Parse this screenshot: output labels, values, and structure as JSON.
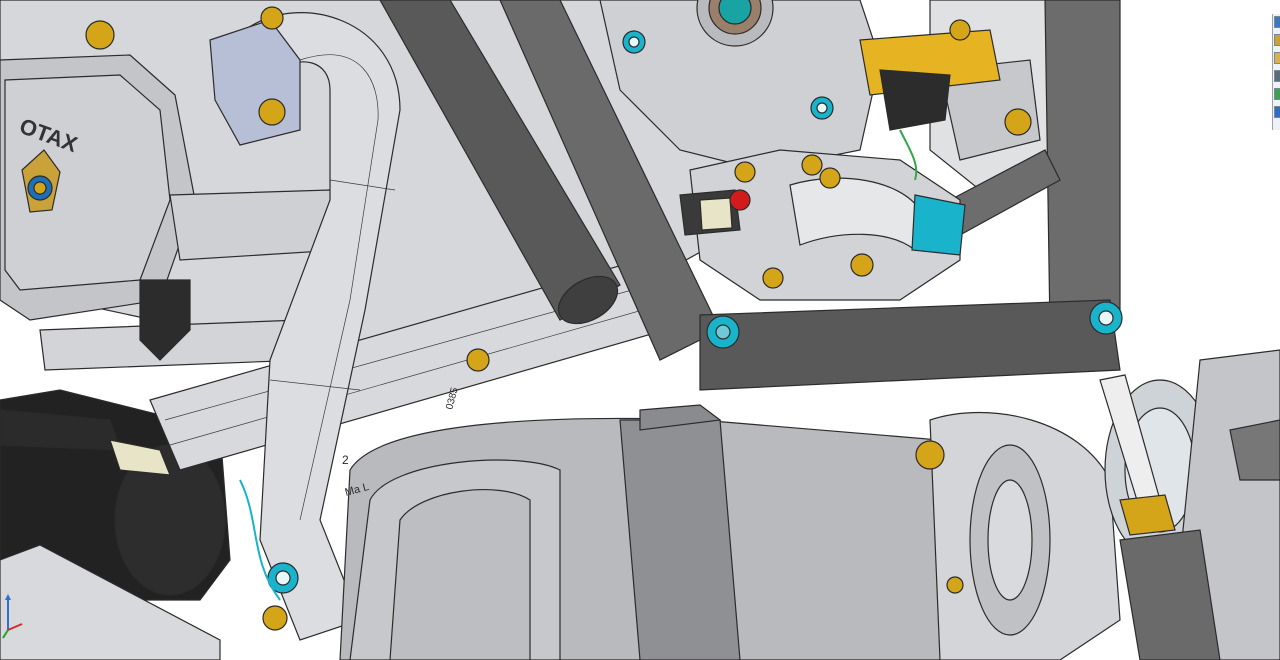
{
  "viewport": {
    "engine_logo_text": "OTAX",
    "part_mark_1": "2",
    "part_mark_2": "Ma L",
    "part_mark_3": "0385"
  },
  "toolbar": {
    "buttons": [
      {
        "name": "view-orientation-icon",
        "color": "#3a78c2"
      },
      {
        "name": "display-style-icon",
        "color": "#c9a33a"
      },
      {
        "name": "hide-show-icon",
        "color": "#d9b04a"
      },
      {
        "name": "section-view-icon",
        "color": "#5a6b7c"
      },
      {
        "name": "appearance-icon",
        "color": "#3aa055"
      },
      {
        "name": "scene-icon",
        "color": "#2f6fc0"
      }
    ]
  },
  "colors": {
    "frame_tube": "#5a5a5a",
    "silver_part": "#c9cbcf",
    "light_part": "#e2e3e5",
    "cyan_washer": "#19b3cc",
    "gold_fastener": "#d4a419",
    "yellow_bracket": "#e6b422",
    "red_marker": "#d21c1c",
    "blue_fitting": "#2a7bc6",
    "hose_black": "#2c2c2c"
  }
}
